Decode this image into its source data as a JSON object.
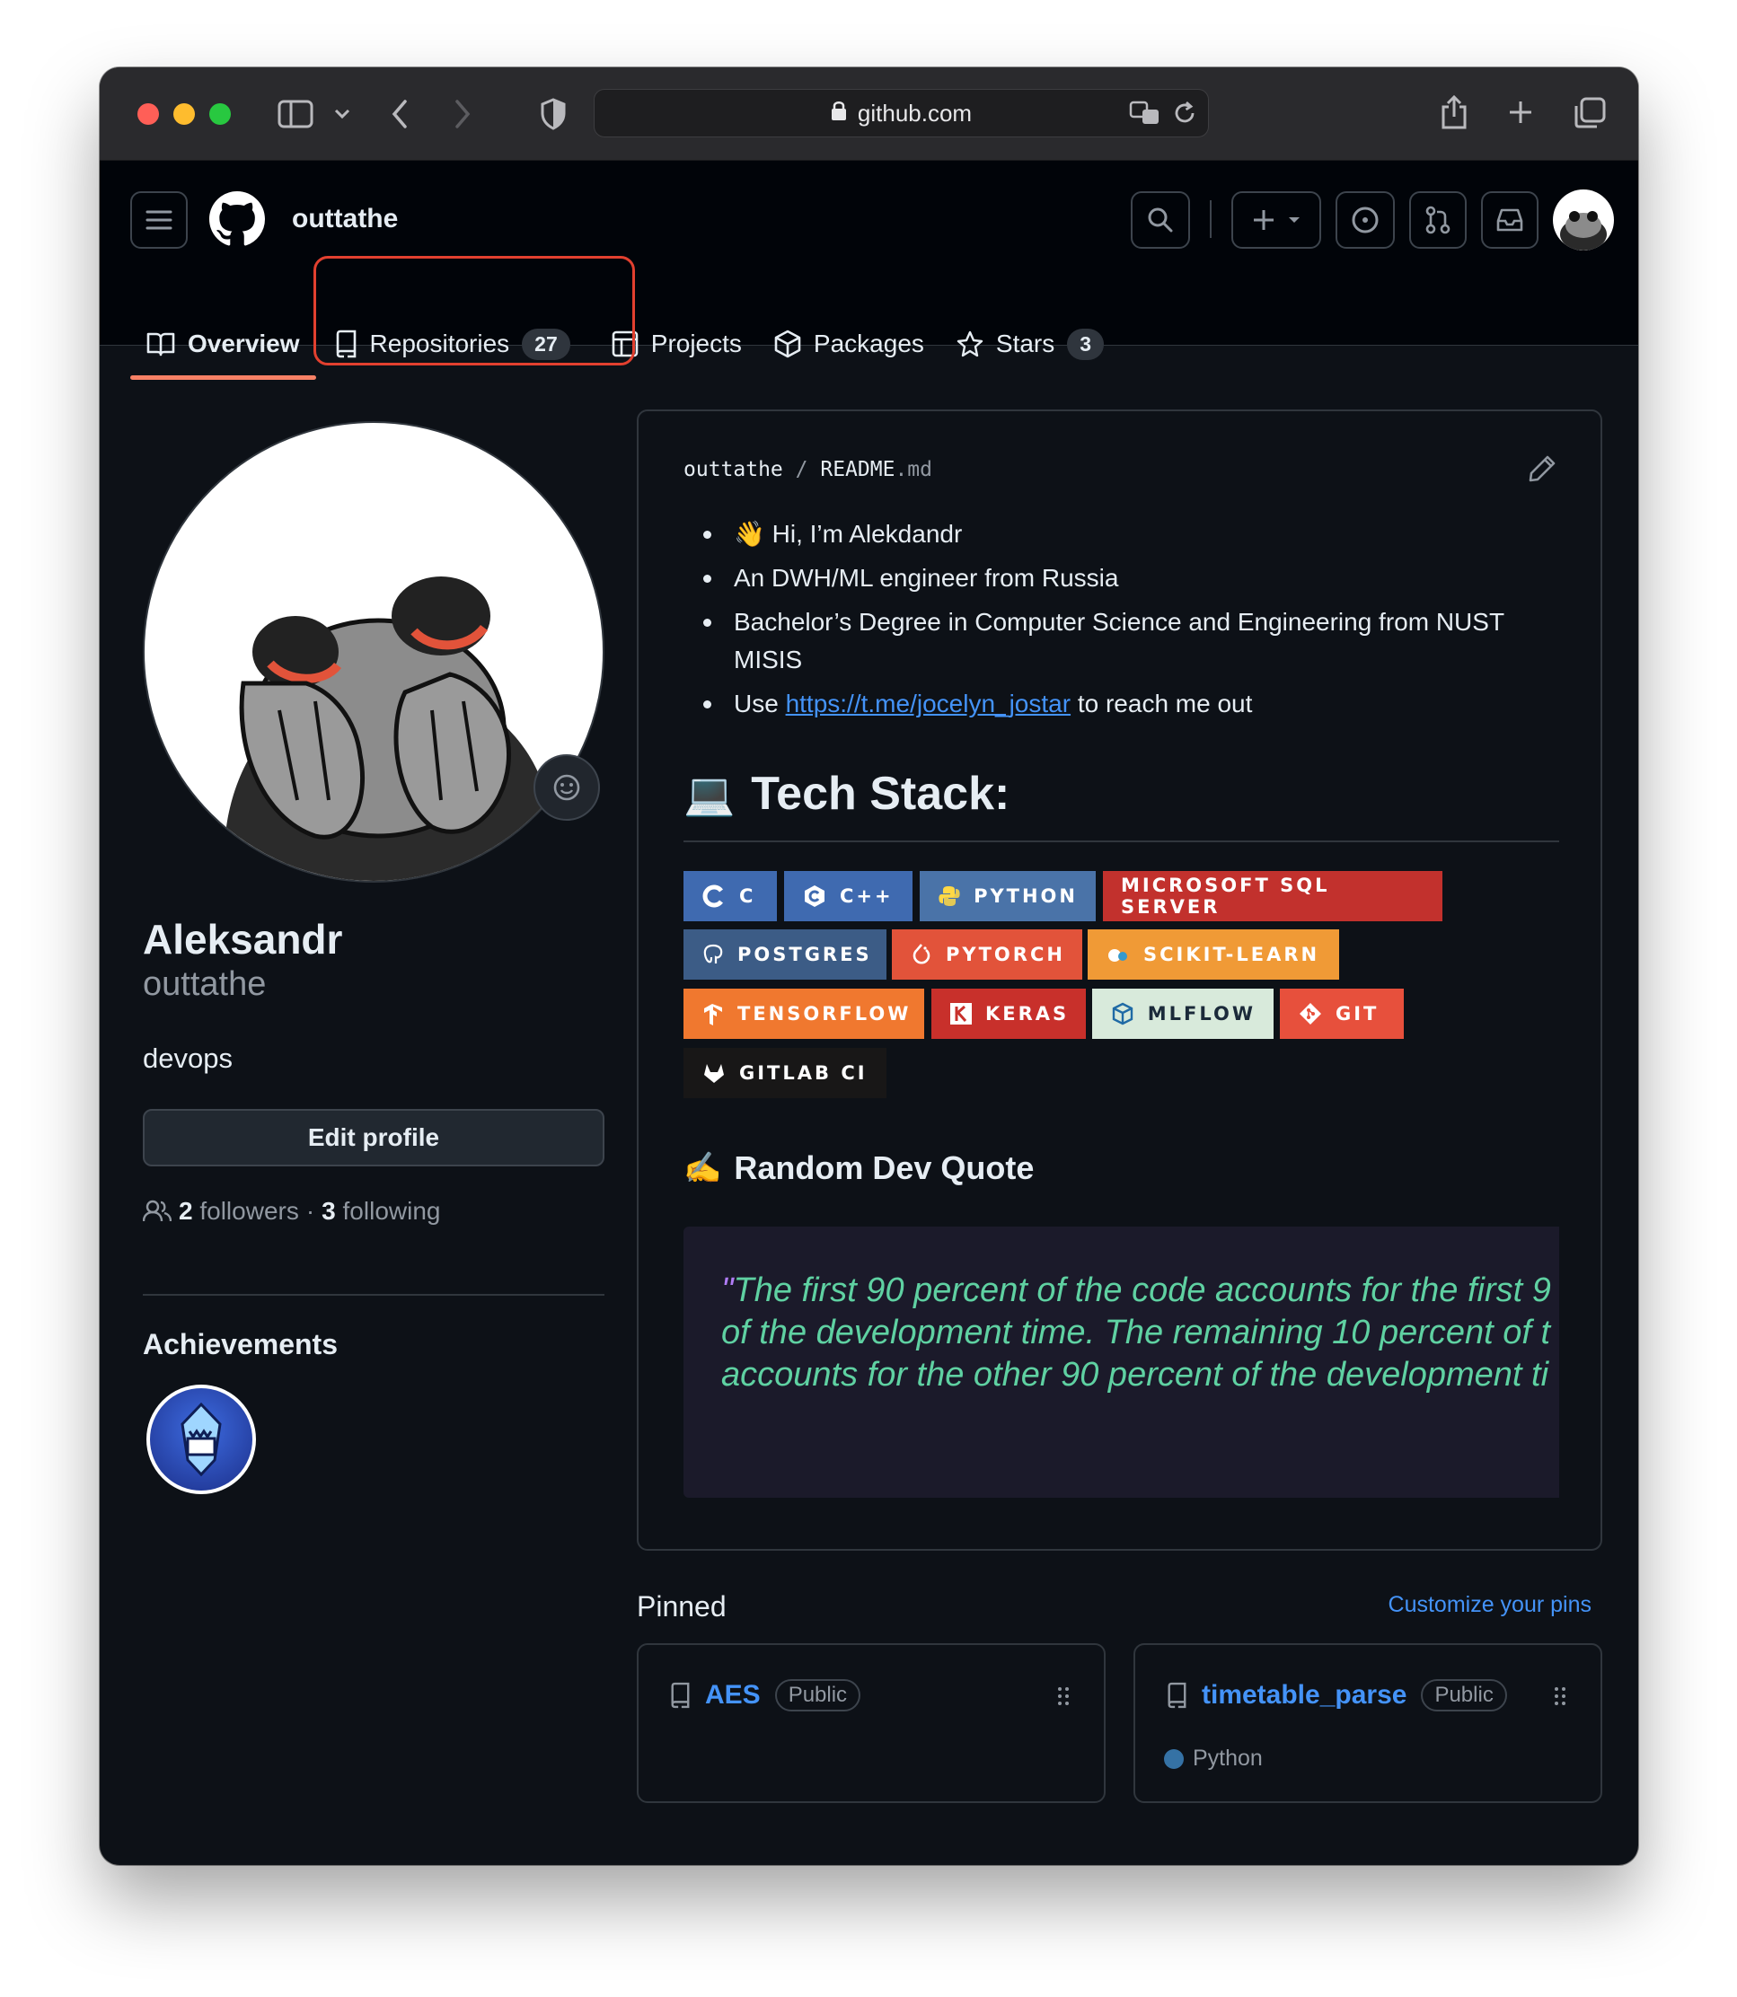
{
  "browser": {
    "url": "github.com"
  },
  "header": {
    "username": "outtathe"
  },
  "tabs": [
    {
      "label": "Overview"
    },
    {
      "label": "Repositories",
      "count": "27"
    },
    {
      "label": "Projects"
    },
    {
      "label": "Packages"
    },
    {
      "label": "Stars",
      "count": "3"
    }
  ],
  "profile": {
    "name": "Aleksandr",
    "login": "outtathe",
    "bio": "devops",
    "edit_label": "Edit profile",
    "followers_count": "2",
    "followers_label": "followers",
    "separator": "·",
    "following_count": "3",
    "following_label": "following",
    "achievements_title": "Achievements"
  },
  "readme": {
    "path_owner": "outtathe",
    "path_sep": "/",
    "path_file": "README",
    "path_ext": ".md",
    "bullets": [
      {
        "text": "👋 Hi, I’m Alekdandr"
      },
      {
        "text": "An DWH/ML engineer from Russia"
      },
      {
        "text": "Bachelor’s Degree in Computer Science and Engineering from NUST MISIS"
      },
      {
        "prefix": "Use ",
        "link": "https://t.me/jocelyn_jostar",
        "suffix": " to reach me out"
      }
    ],
    "tech_heading": "Tech Stack:",
    "tech_emoji": "💻",
    "badges": [
      {
        "label": "C",
        "icon": "c-logo",
        "color": "#3f6ab0"
      },
      {
        "label": "C++",
        "icon": "cpp-logo",
        "color": "#3f6ab0"
      },
      {
        "label": "PYTHON",
        "icon": "python-logo",
        "color": "#4a73a8"
      },
      {
        "label": "MICROSOFT SQL SERVER",
        "icon": "none",
        "color": "#c2312d"
      },
      {
        "label": "POSTGRES",
        "icon": "postgres-logo",
        "color": "#3c5c86"
      },
      {
        "label": "PYTORCH",
        "icon": "pytorch-logo",
        "color": "#e2533a"
      },
      {
        "label": "SCIKIT-LEARN",
        "icon": "scikit-logo",
        "color": "#f09a36"
      },
      {
        "label": "TENSORFLOW",
        "icon": "tensorflow-logo",
        "color": "#f0782f"
      },
      {
        "label": "KERAS",
        "icon": "keras-logo",
        "color": "#c8302b"
      },
      {
        "label": "MLFLOW",
        "icon": "mlflow-logo",
        "color": "#d8eadb"
      },
      {
        "label": "GIT",
        "icon": "git-logo",
        "color": "#e7503c"
      },
      {
        "label": "GITLAB CI",
        "icon": "gitlab-logo",
        "color": "#181717"
      }
    ],
    "quote_heading": "Random Dev Quote",
    "quote_emoji": "✍️",
    "quote_mark": "\"",
    "quote_text": "The first 90 percent of the code accounts for the first 9\nof the development time. The remaining 10 percent of t\naccounts for the other 90 percent of the development ti"
  },
  "pinned": {
    "title": "Pinned",
    "customize": "Customize your pins",
    "repos": [
      {
        "name": "AES",
        "visibility": "Public"
      },
      {
        "name": "timetable_parse",
        "visibility": "Public",
        "language": "Python",
        "language_color": "#3572A5"
      }
    ]
  }
}
